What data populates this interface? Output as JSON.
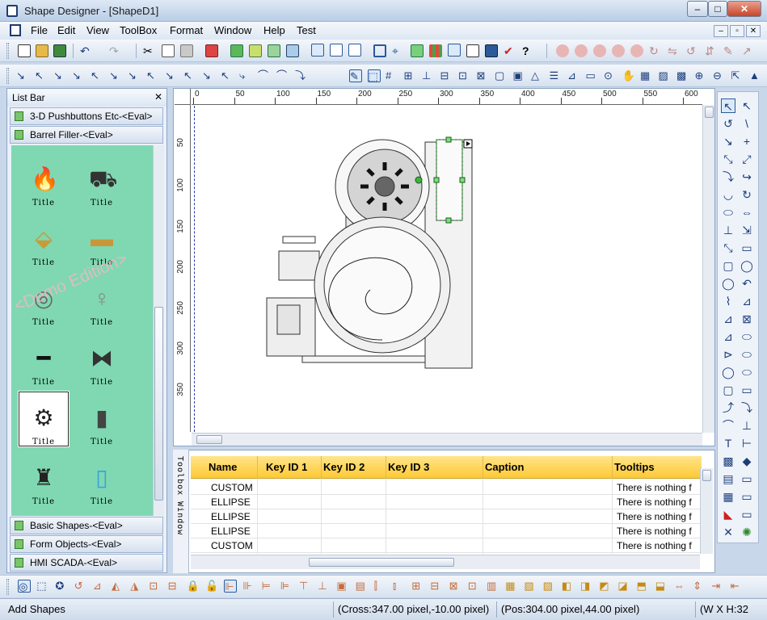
{
  "window": {
    "title": "Shape Designer - [ShapeD1]",
    "minimize": "–",
    "maximize": "□",
    "close": "✕"
  },
  "menubar": {
    "items": [
      "File",
      "Edit",
      "View",
      "ToolBox",
      "Format",
      "Window",
      "Help",
      "Test"
    ],
    "mdi": [
      "–",
      "▫",
      "✕"
    ]
  },
  "listbar": {
    "title": "List Bar",
    "close": "✕",
    "groups_top": [
      "3-D Pushbuttons Etc-<Eval>",
      "Barrel Filler-<Eval>"
    ],
    "groups_bottom": [
      "Basic Shapes-<Eval>",
      "Form Objects-<Eval>",
      "HMI SCADA-<Eval>"
    ],
    "palette_items": [
      {
        "title": "Title",
        "icon": "flame-icon"
      },
      {
        "title": "Title",
        "icon": "forklift-icon"
      },
      {
        "title": "Title",
        "icon": "hopper-icon"
      },
      {
        "title": "Title",
        "icon": "conveyor-icon"
      },
      {
        "title": "Title",
        "icon": "pump-icon"
      },
      {
        "title": "Title",
        "icon": "valve-icon"
      },
      {
        "title": "Title",
        "icon": "line-icon"
      },
      {
        "title": "Title",
        "icon": "butterfly-valve-icon"
      },
      {
        "title": "Title",
        "icon": "motor-pump-icon"
      },
      {
        "title": "Title",
        "icon": "cylinder-icon"
      },
      {
        "title": "Title",
        "icon": "actuator-icon"
      },
      {
        "title": "Title",
        "icon": "tank-icon"
      }
    ],
    "watermark": "<Demo Edition>"
  },
  "ruler": {
    "h_ticks": [
      "0",
      "50",
      "100",
      "150",
      "200",
      "250",
      "300",
      "350",
      "400",
      "450",
      "500",
      "550",
      "600"
    ],
    "v_ticks": [
      "50",
      "100",
      "150",
      "200",
      "250",
      "300",
      "350"
    ]
  },
  "toolbox_window": {
    "label": "Toolbox Window"
  },
  "grid": {
    "columns": [
      "Name",
      "Key ID 1",
      "Key ID 2",
      "Key ID 3",
      "Caption",
      "Tooltips"
    ],
    "rows": [
      {
        "name": "CUSTOM",
        "tooltip": "There is nothing f"
      },
      {
        "name": "ELLIPSE",
        "tooltip": "There is nothing f"
      },
      {
        "name": "ELLIPSE",
        "tooltip": "There is nothing f"
      },
      {
        "name": "ELLIPSE",
        "tooltip": "There is nothing f"
      },
      {
        "name": "CUSTOM",
        "tooltip": "There is nothing f"
      }
    ]
  },
  "statusbar": {
    "mode": "Add Shapes",
    "cross": "(Cross:347.00 pixel,-10.00 pixel)",
    "pos": "(Pos:304.00 pixel,44.00 pixel)",
    "size": "(W X H:32"
  },
  "colors": {
    "palette_bg": "#7fd8b1",
    "grid_header": "#ffd04a",
    "accent": "#1e3c6e"
  }
}
